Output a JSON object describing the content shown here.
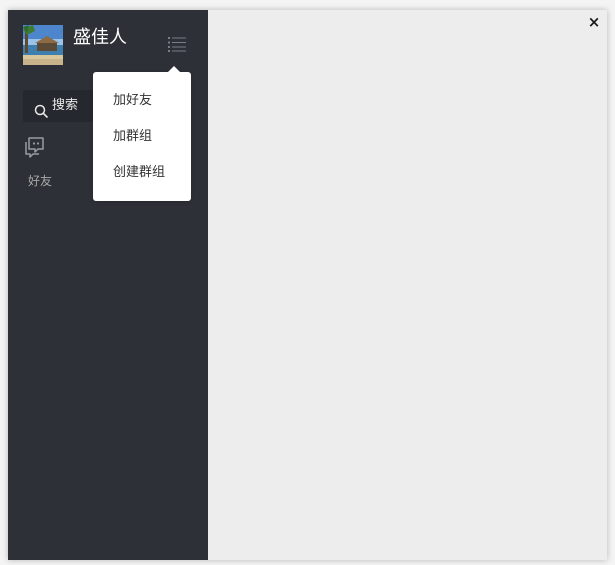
{
  "user": {
    "name": "盛佳人",
    "avatar_icon": "avatar-beach-photo"
  },
  "header": {
    "menu_icon": "list-menu-icon"
  },
  "search": {
    "label": "搜索",
    "icon": "search-icon"
  },
  "nav": {
    "friends_icon": "chat-bubble-icon",
    "friends_label": "好友"
  },
  "dropdown": {
    "items": [
      {
        "label": "加好友"
      },
      {
        "label": "加群组"
      },
      {
        "label": "创建群组"
      }
    ]
  },
  "window": {
    "close_label": "×"
  },
  "colors": {
    "sidebar_bg": "#2e3038",
    "content_bg": "#ededed",
    "dropdown_bg": "#ffffff"
  }
}
